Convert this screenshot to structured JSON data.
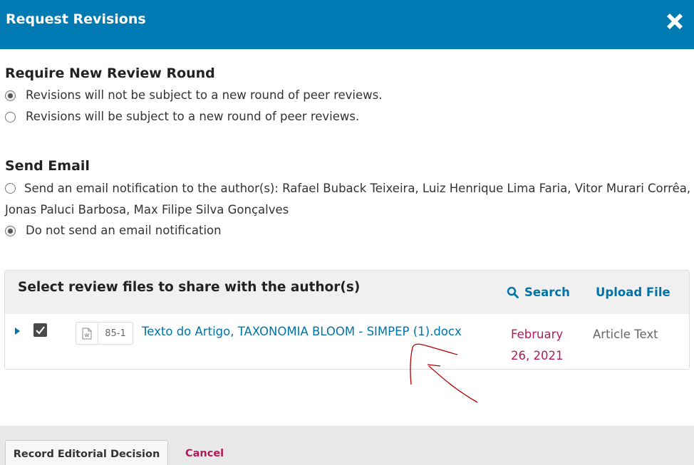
{
  "modal": {
    "title": "Request Revisions",
    "close_icon": "close-icon"
  },
  "review_round": {
    "heading": "Require New Review Round",
    "options": [
      {
        "label": "Revisions will not be subject to a new round of peer reviews.",
        "checked": true
      },
      {
        "label": "Revisions will be subject to a new round of peer reviews.",
        "checked": false
      }
    ]
  },
  "send_email": {
    "heading": "Send Email",
    "options": [
      {
        "label": "Send an email notification to the author(s): Rafael Buback Teixeira, Luiz Henrique Lima Faria, Vitor Murari Corrêa, Jonas Paluci Barbosa, Max Filipe Silva Gonçalves",
        "checked": false
      },
      {
        "label": "Do not send an email notification",
        "checked": true
      }
    ]
  },
  "review_files": {
    "heading": "Select review files to share with the author(s)",
    "search_label": "Search",
    "upload_label": "Upload File",
    "files": [
      {
        "selected": true,
        "file_icon": "word-document-icon",
        "id": "85-1",
        "name": "Texto do Artigo, TAXONOMIA BLOOM - SIMPEP (1).docx",
        "date": "February 26, 2021",
        "type": "Article Text"
      }
    ]
  },
  "footer": {
    "record_label": "Record Editorial Decision",
    "cancel_label": "Cancel"
  },
  "colors": {
    "header_bg": "#007ab2",
    "link": "#0073a8",
    "accent_date": "#b01c5b",
    "annotation": "#b00000"
  }
}
